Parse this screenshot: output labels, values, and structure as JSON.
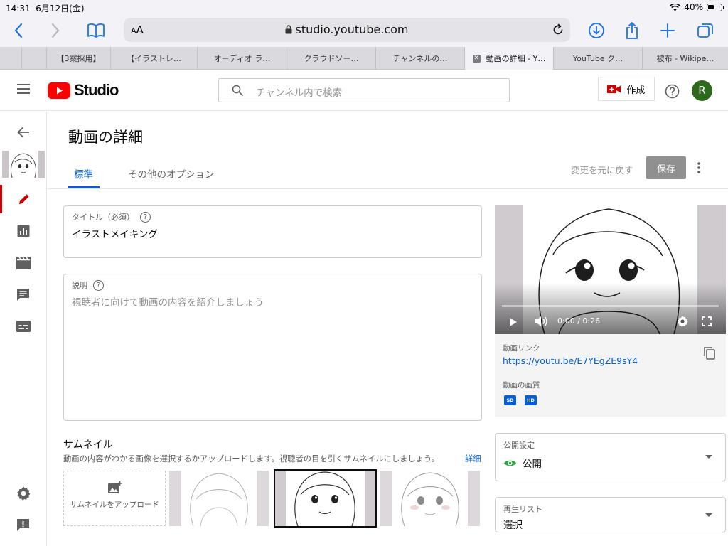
{
  "status_bar": {
    "time": "14:31",
    "date": "6月12日(金)",
    "battery": "40%"
  },
  "browser": {
    "text_size_label": "AA",
    "url": "studio.youtube.com",
    "tabs": [
      {
        "label": ""
      },
      {
        "label": "【3案採用】"
      },
      {
        "label": "【イラストレ…"
      },
      {
        "label": "オーディオ ラ…"
      },
      {
        "label": "クラウドソー…"
      },
      {
        "label": "チャンネルの…"
      },
      {
        "label": "動画の詳細 - Y…",
        "active": true
      },
      {
        "label": "YouTube ク…"
      },
      {
        "label": "被布 - Wikipe…"
      }
    ]
  },
  "header": {
    "logo_text": "Studio",
    "search_placeholder": "チャンネル内で検索",
    "create_label": "作成",
    "avatar_initial": "R"
  },
  "main": {
    "page_title": "動画の詳細",
    "tabs": [
      {
        "label": "標準",
        "active": true
      },
      {
        "label": "その他のオプション"
      }
    ],
    "undo_label": "変更を元に戻す",
    "save_label": "保存",
    "title_field": {
      "label": "タイトル（必須）",
      "value": "イラストメイキング"
    },
    "description_field": {
      "label": "説明",
      "placeholder": "視聴者に向けて動画の内容を紹介しましょう"
    },
    "thumbnail": {
      "heading": "サムネイル",
      "description": "動画の内容がわかる画像を選択するかアップロードします。視聴者の目を引くサムネイルにしましょう。",
      "learn_more": "詳細",
      "upload_label": "サムネイルをアップロード"
    }
  },
  "video_panel": {
    "time": "0:00 / 0:26",
    "link_label": "動画リンク",
    "link_url": "https://youtu.be/E7YEgZE9sY4",
    "quality_label": "動画の画質",
    "quality_badges": [
      "SD",
      "HD"
    ]
  },
  "visibility": {
    "label": "公開設定",
    "value": "公開"
  },
  "playlist": {
    "label": "再生リスト",
    "value": "選択"
  },
  "colors": {
    "accent": "#065fd4",
    "brand_red": "#ff0000",
    "avatar_green": "#2e6a1e",
    "active_red": "#cc0000"
  }
}
